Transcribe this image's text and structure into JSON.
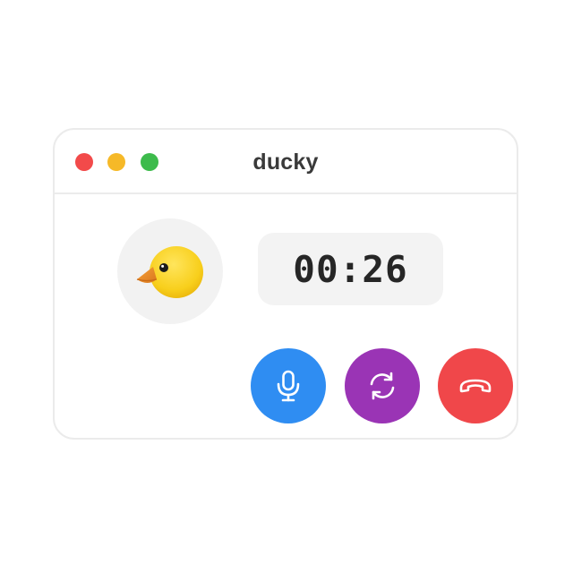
{
  "window": {
    "title": "ducky",
    "traffic_lights": {
      "close": "#f24a4a",
      "minimize": "#f6b928",
      "maximize": "#3dbb4c"
    }
  },
  "caller": {
    "avatar": "duck-emoji-icon"
  },
  "call": {
    "timer": "00:26"
  },
  "controls": [
    {
      "name": "microphone",
      "icon": "microphone-icon",
      "color": "#2f8df2"
    },
    {
      "name": "switch-camera",
      "icon": "refresh-icon",
      "color": "#9a34b5"
    },
    {
      "name": "end-call",
      "icon": "phone-hangup-icon",
      "color": "#f0474a"
    }
  ]
}
